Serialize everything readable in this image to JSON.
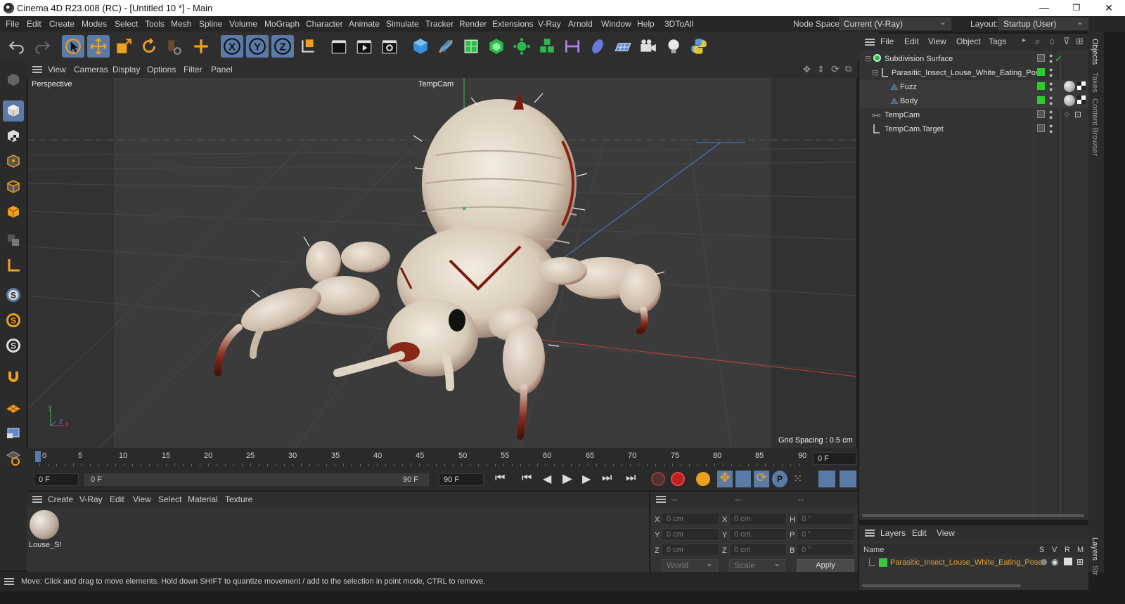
{
  "window": {
    "title": "Cinema 4D R23.008 (RC) - [Untitled 10 *] - Main",
    "minimize": "—",
    "restore": "❐",
    "close": "✕"
  },
  "menubar": {
    "items": [
      "File",
      "Edit",
      "Create",
      "Modes",
      "Select",
      "Tools",
      "Mesh",
      "Spline",
      "Volume",
      "MoGraph",
      "Character",
      "Animate",
      "Simulate",
      "Tracker",
      "Render",
      "Extensions",
      "V-Ray",
      "Arnold",
      "Window",
      "Help",
      "3DToAll"
    ],
    "node_space_label": "Node Space:",
    "node_space_value": "Current (V-Ray)",
    "layout_label": "Layout:",
    "layout_value": "Startup (User)"
  },
  "viewport": {
    "menu": [
      "View",
      "Cameras",
      "Display",
      "Options",
      "Filter",
      "Panel"
    ],
    "view_name": "Perspective",
    "camera_name": "TempCam",
    "grid_spacing": "Grid Spacing : 0.5 cm",
    "axis_y": "y",
    "axis_z": "z",
    "axis_x": "x"
  },
  "timeline": {
    "ticks": [
      "0",
      "5",
      "10",
      "15",
      "20",
      "25",
      "30",
      "35",
      "40",
      "45",
      "50",
      "55",
      "60",
      "65",
      "70",
      "75",
      "80",
      "85",
      "90"
    ],
    "current_frame": "0 F",
    "start_frame": "0 F",
    "range_start": "0 F",
    "range_end": "90 F",
    "end_frame": "90 F"
  },
  "material_manager": {
    "menu": [
      "Create",
      "V-Ray",
      "Edit",
      "View",
      "Select",
      "Material",
      "Texture"
    ],
    "materials": [
      {
        "name": "Louse_S!"
      }
    ]
  },
  "coordinates": {
    "header": [
      "--",
      "--",
      "--"
    ],
    "rows": [
      {
        "a": "X",
        "av": "0 cm",
        "b": "X",
        "bv": "0 cm",
        "c": "H",
        "cv": "0 °"
      },
      {
        "a": "Y",
        "av": "0 cm",
        "b": "Y",
        "bv": "0 cm",
        "c": "P",
        "cv": "0 °"
      },
      {
        "a": "Z",
        "av": "0 cm",
        "b": "Z",
        "bv": "0 cm",
        "c": "B",
        "cv": "0 °"
      }
    ],
    "mode": "World",
    "transform": "Scale",
    "apply": "Apply"
  },
  "object_manager": {
    "menu": [
      "File",
      "Edit",
      "View",
      "Object",
      "Tags"
    ],
    "objects": [
      {
        "name": "Subdivision Surface"
      },
      {
        "name": "Parasitic_Insect_Louse_White_Eating_Pose"
      },
      {
        "name": "Fuzz"
      },
      {
        "name": "Body"
      },
      {
        "name": "TempCam"
      },
      {
        "name": "TempCam.Target"
      }
    ],
    "side_tabs": [
      "Objects",
      "Takes",
      "Content Browser"
    ]
  },
  "layer_manager": {
    "menu": [
      "Layers",
      "Edit",
      "View"
    ],
    "columns": [
      "Name",
      "S",
      "V",
      "R",
      "M"
    ],
    "layers": [
      {
        "name": "Parasitic_Insect_Louse_White_Eating_Pose",
        "color": "#3ec43e"
      }
    ],
    "side_tabs": [
      "Layers",
      "Str"
    ]
  },
  "status": {
    "message": "Move: Click and drag to move elements. Hold down SHIFT to quantize movement / add to the selection in point mode, CTRL to remove."
  },
  "colors": {
    "accent": "#5a7aa8",
    "green_dot": "#2ecc2e",
    "layer_name": "#e8a23a"
  }
}
